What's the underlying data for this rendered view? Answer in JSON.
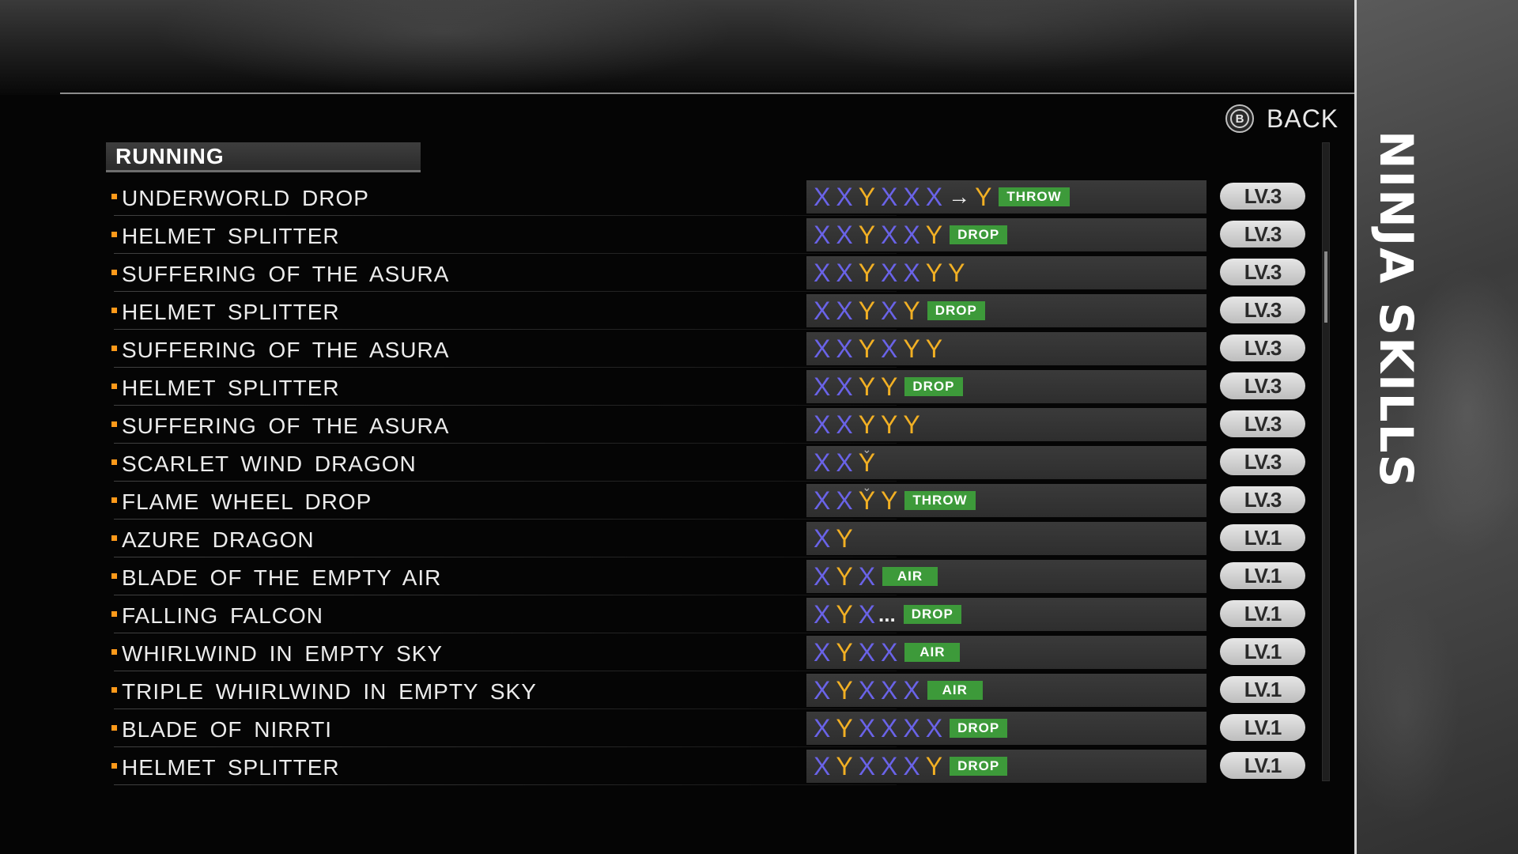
{
  "header": {
    "back_label": "BACK",
    "back_button_glyph": "B",
    "panel_title": "NINJA SKILLS"
  },
  "section": {
    "title": "RUNNING"
  },
  "skills": [
    {
      "name": "UNDERWORLD DROP",
      "combo": [
        {
          "k": "X"
        },
        {
          "k": "X"
        },
        {
          "k": "Y"
        },
        {
          "k": "X"
        },
        {
          "k": "X"
        },
        {
          "k": "X"
        },
        {
          "k": "arrow"
        },
        {
          "k": "Y"
        }
      ],
      "tag": "THROW",
      "level": "LV.3"
    },
    {
      "name": "HELMET SPLITTER",
      "combo": [
        {
          "k": "X"
        },
        {
          "k": "X"
        },
        {
          "k": "Y"
        },
        {
          "k": "X"
        },
        {
          "k": "X"
        },
        {
          "k": "Y"
        }
      ],
      "tag": "DROP",
      "level": "LV.3"
    },
    {
      "name": "SUFFERING OF THE ASURA",
      "combo": [
        {
          "k": "X"
        },
        {
          "k": "X"
        },
        {
          "k": "Y"
        },
        {
          "k": "X"
        },
        {
          "k": "X"
        },
        {
          "k": "Y"
        },
        {
          "k": "Y"
        }
      ],
      "tag": "",
      "level": "LV.3"
    },
    {
      "name": "HELMET SPLITTER",
      "combo": [
        {
          "k": "X"
        },
        {
          "k": "X"
        },
        {
          "k": "Y"
        },
        {
          "k": "X"
        },
        {
          "k": "Y"
        }
      ],
      "tag": "DROP",
      "level": "LV.3"
    },
    {
      "name": "SUFFERING OF THE ASURA",
      "combo": [
        {
          "k": "X"
        },
        {
          "k": "X"
        },
        {
          "k": "Y"
        },
        {
          "k": "X"
        },
        {
          "k": "Y"
        },
        {
          "k": "Y"
        }
      ],
      "tag": "",
      "level": "LV.3"
    },
    {
      "name": "HELMET SPLITTER",
      "combo": [
        {
          "k": "X"
        },
        {
          "k": "X"
        },
        {
          "k": "Y"
        },
        {
          "k": "Y"
        }
      ],
      "tag": "DROP",
      "level": "LV.3"
    },
    {
      "name": "SUFFERING OF THE ASURA",
      "combo": [
        {
          "k": "X"
        },
        {
          "k": "X"
        },
        {
          "k": "Y"
        },
        {
          "k": "Y"
        },
        {
          "k": "Y"
        }
      ],
      "tag": "",
      "level": "LV.3"
    },
    {
      "name": "SCARLET WIND DRAGON",
      "combo": [
        {
          "k": "X"
        },
        {
          "k": "X"
        },
        {
          "k": "Y",
          "hold": true
        }
      ],
      "tag": "",
      "level": "LV.3"
    },
    {
      "name": "FLAME WHEEL DROP",
      "combo": [
        {
          "k": "X"
        },
        {
          "k": "X"
        },
        {
          "k": "Y",
          "hold": true
        },
        {
          "k": "Y"
        }
      ],
      "tag": "THROW",
      "level": "LV.3"
    },
    {
      "name": "AZURE DRAGON",
      "combo": [
        {
          "k": "X"
        },
        {
          "k": "Y"
        }
      ],
      "tag": "",
      "level": "LV.1"
    },
    {
      "name": "BLADE OF THE EMPTY AIR",
      "combo": [
        {
          "k": "X"
        },
        {
          "k": "Y"
        },
        {
          "k": "X"
        }
      ],
      "tag": "AIR",
      "level": "LV.1"
    },
    {
      "name": "FALLING FALCON",
      "combo": [
        {
          "k": "X"
        },
        {
          "k": "Y"
        },
        {
          "k": "X"
        },
        {
          "k": "dots"
        }
      ],
      "tag": "DROP",
      "level": "LV.1"
    },
    {
      "name": "WHIRLWIND IN EMPTY SKY",
      "combo": [
        {
          "k": "X"
        },
        {
          "k": "Y"
        },
        {
          "k": "X"
        },
        {
          "k": "X"
        }
      ],
      "tag": "AIR",
      "level": "LV.1"
    },
    {
      "name": "TRIPLE WHIRLWIND IN EMPTY SKY",
      "combo": [
        {
          "k": "X"
        },
        {
          "k": "Y"
        },
        {
          "k": "X"
        },
        {
          "k": "X"
        },
        {
          "k": "X"
        }
      ],
      "tag": "AIR",
      "level": "LV.1"
    },
    {
      "name": "BLADE OF NIRRTI",
      "combo": [
        {
          "k": "X"
        },
        {
          "k": "Y"
        },
        {
          "k": "X"
        },
        {
          "k": "X"
        },
        {
          "k": "X"
        },
        {
          "k": "X"
        }
      ],
      "tag": "DROP",
      "level": "LV.1"
    },
    {
      "name": "HELMET SPLITTER",
      "combo": [
        {
          "k": "X"
        },
        {
          "k": "Y"
        },
        {
          "k": "X"
        },
        {
          "k": "X"
        },
        {
          "k": "X"
        },
        {
          "k": "Y"
        }
      ],
      "tag": "DROP",
      "level": "LV.1"
    }
  ],
  "glyphs": {
    "arrow": "→",
    "dots": "...",
    "hold": "⌄"
  },
  "colors": {
    "x_button": "#6a63e8",
    "y_button": "#f2b024",
    "tag_green": "#3d9a3a",
    "bullet_orange": "#ff9a1a"
  },
  "scroll": {
    "position_fraction": 0.17
  }
}
